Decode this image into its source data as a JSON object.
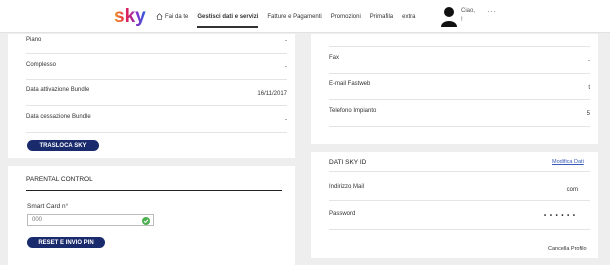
{
  "header": {
    "nav": [
      {
        "label": "Fai da te",
        "name": "nav-fai-da-te",
        "icon": "home-icon"
      },
      {
        "label": "Gestisci dati e servizi",
        "name": "nav-gestisci",
        "active": true
      },
      {
        "label": "Fatture e Pagamenti",
        "name": "nav-fatture"
      },
      {
        "label": "Promozioni",
        "name": "nav-promozioni"
      },
      {
        "label": "Primafila",
        "name": "nav-primafila"
      },
      {
        "label": "extra",
        "name": "nav-extra"
      }
    ],
    "greeting_line1": "Ciao,",
    "greeting_line2": "!",
    "more": "···"
  },
  "left_card": {
    "rows": [
      {
        "label": "Piano",
        "value": "-"
      },
      {
        "label": "Complesso",
        "value": "-"
      },
      {
        "label": "Data attivazione Bundle",
        "value": "16/11/2017"
      },
      {
        "label": "Data cessazione Bundle",
        "value": "-"
      }
    ],
    "button_label": "TRASLOCA SKY"
  },
  "parental": {
    "title": "PARENTAL CONTROL",
    "smart_card_label": "Smart Card n°",
    "smart_card_value": "000",
    "button_label": "RESET E INVIO PIN"
  },
  "right_card": {
    "rows": [
      {
        "label": "Fax",
        "value": "-"
      },
      {
        "label": "E-mail Fastweb",
        "value": "t"
      },
      {
        "label": "Telefono Impianto",
        "value": "5"
      }
    ]
  },
  "sky_id": {
    "title": "DATI SKY ID",
    "edit_link": "Modifica Dati",
    "rows": [
      {
        "label": "Indirizzo Mail",
        "value": "com"
      },
      {
        "label": "Password",
        "value": "• • • • • •"
      }
    ],
    "delete_link": "Cancella Profilo"
  },
  "colors": {
    "accent": "#1a2b6d",
    "link": "#3a5bb8",
    "check": "#4caf50"
  }
}
